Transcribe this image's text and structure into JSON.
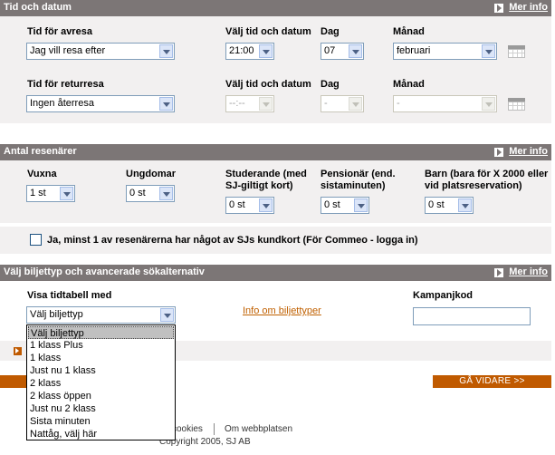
{
  "sections": {
    "time": {
      "title": "Tid och datum",
      "more": "Mer info"
    },
    "travelers": {
      "title": "Antal resenärer",
      "more": "Mer info"
    },
    "ticket": {
      "title": "Välj biljettyp och avancerade sökalternativ",
      "more": "Mer info"
    }
  },
  "departure": {
    "label": "Tid för avresa",
    "value": "Jag vill resa efter",
    "time_label": "Välj tid och datum",
    "time_value": "21:00",
    "day_label": "Dag",
    "day_value": "07",
    "month_label": "Månad",
    "month_value": "februari"
  },
  "return": {
    "label": "Tid för returresa",
    "value": "Ingen återresa",
    "time_label": "Välj tid och datum",
    "time_value": "--:--",
    "day_label": "Dag",
    "day_value": "-",
    "month_label": "Månad",
    "month_value": "-"
  },
  "travelers": {
    "adults": {
      "label": "Vuxna",
      "value": "1 st"
    },
    "youth": {
      "label": "Ungdomar",
      "value": "0 st"
    },
    "students": {
      "label1": "Studerande (med",
      "label2": "SJ-giltigt kort)",
      "value": "0 st"
    },
    "seniors": {
      "label1": "Pensionär (end.",
      "label2": "sistaminuten)",
      "value": "0 st"
    },
    "children": {
      "label1": "Barn (bara för X 2000 eller",
      "label2": "vid platsreservation)",
      "value": "0 st"
    },
    "card_check_label": "Ja, minst 1 av resenärerna har något av SJs kundkort (För Commeo - logga in)"
  },
  "ticket": {
    "timetable_label": "Visa tidtabell med",
    "select_value": "Välj biljettyp",
    "info_link": "Info om biljettyper",
    "campaign_label": "Kampanjkod",
    "campaign_value": "",
    "options": [
      "Välj biljettyp",
      "1 klass Plus",
      "1 klass",
      "Just nu 1 klass",
      "2 klass",
      "2 klass öppen",
      "Just nu 2 klass",
      "Sista minuten",
      "Nattåg, välj här"
    ]
  },
  "actions": {
    "go": "GÅ VIDARE >>"
  },
  "footer": {
    "cookies": "cookies",
    "about": "Om webbplatsen",
    "copyright": "Copyright 2005, SJ AB"
  },
  "colors": {
    "header_bar": "#7c7676",
    "panel": "#f2f0f0",
    "accent": "#c05a00",
    "link": "#c06000"
  }
}
